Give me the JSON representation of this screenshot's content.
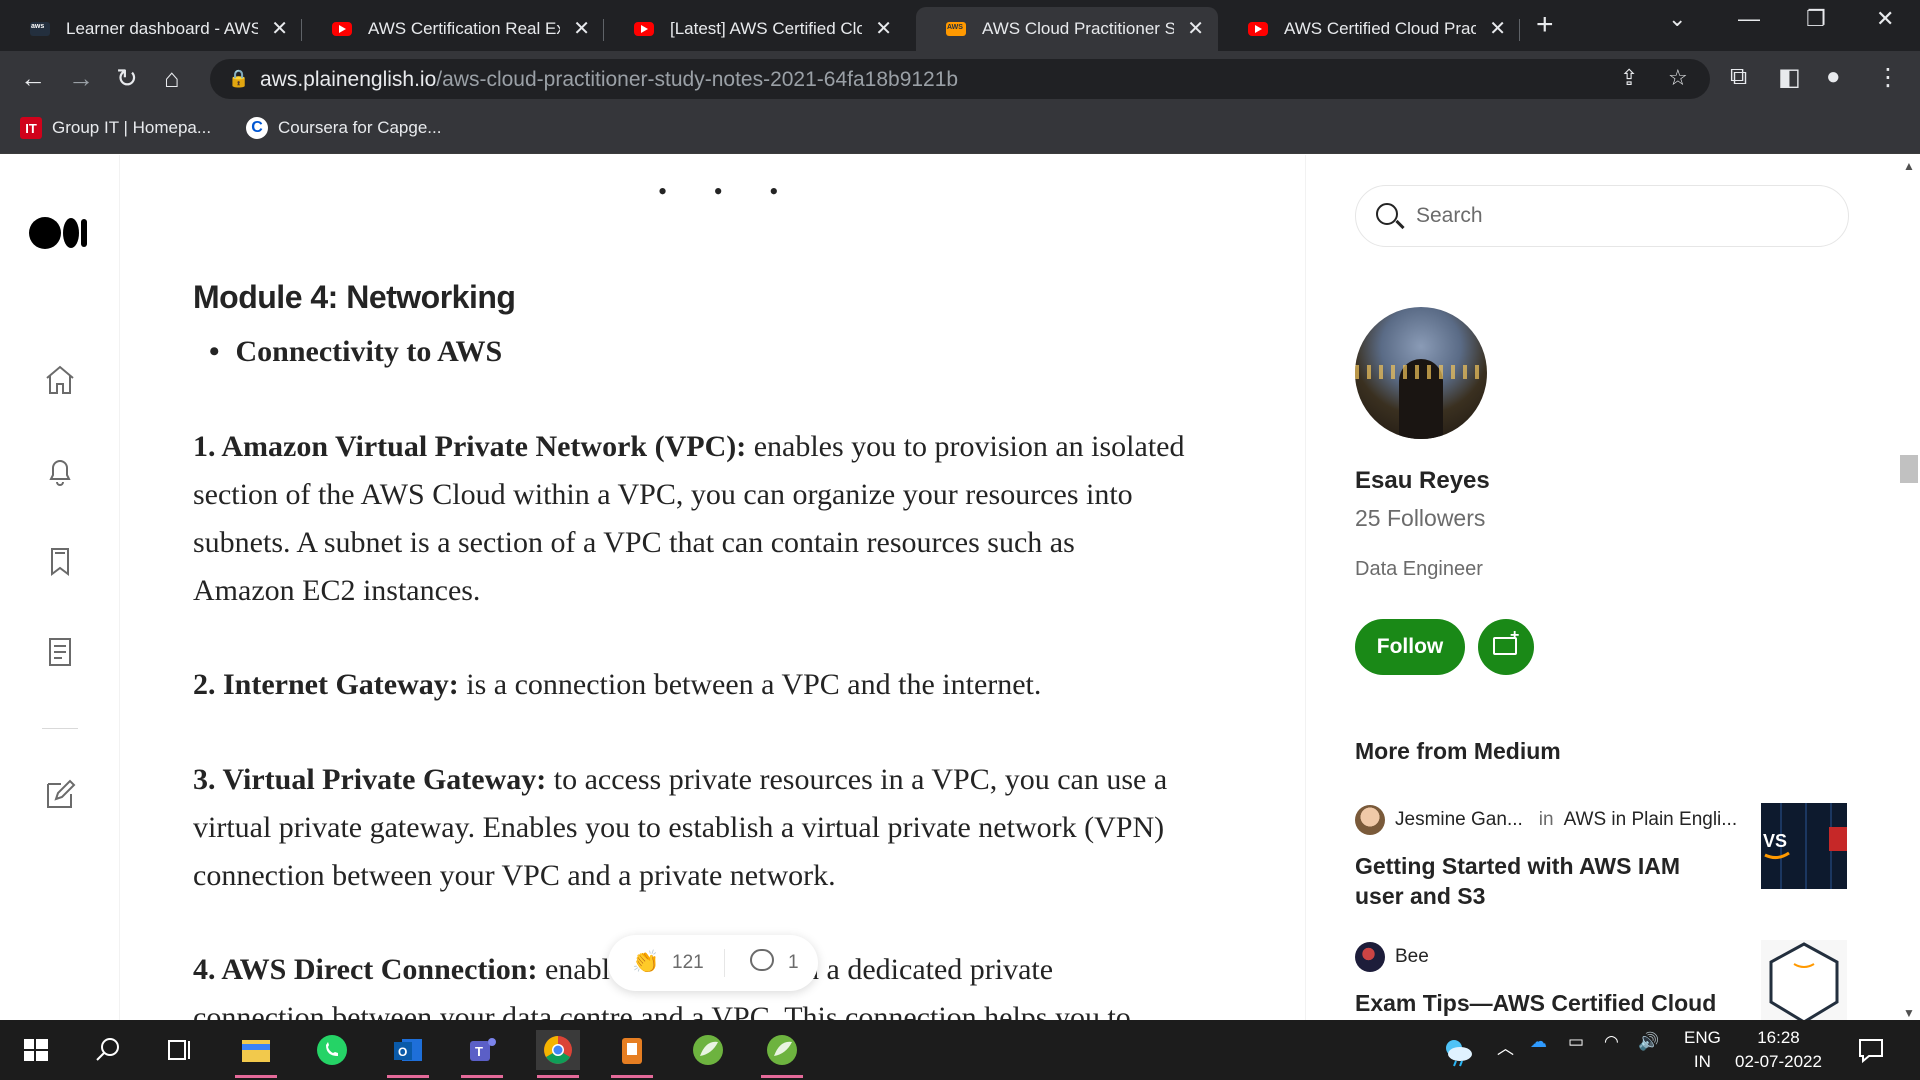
{
  "browser": {
    "tabs": [
      {
        "title": "Learner dashboard - AWS",
        "favicon": "aws-icon",
        "active": false
      },
      {
        "title": "AWS Certification Real Exa",
        "favicon": "youtube-icon",
        "active": false
      },
      {
        "title": "[Latest] AWS Certified Clo",
        "favicon": "youtube-icon",
        "active": false
      },
      {
        "title": "AWS Cloud Practitioner St",
        "favicon": "aws-orange-icon",
        "active": true
      },
      {
        "title": "AWS Certified Cloud Pract",
        "favicon": "youtube-icon",
        "active": false
      }
    ],
    "url_host": "aws.plainenglish.io",
    "url_path": "/aws-cloud-practitioner-study-notes-2021-64fa18b9121b",
    "bookmarks": [
      {
        "label": "Group IT | Homepa...",
        "icon": "IT"
      },
      {
        "label": "Coursera for Capge...",
        "icon": "C"
      }
    ]
  },
  "article": {
    "separator": "• • •",
    "heading": "Module 4: Networking",
    "bullet": "Connectivity to AWS",
    "paragraphs": [
      {
        "bold": "1. Amazon Virtual Private Network (VPC):",
        "lines": [
          "enables you to provision an isolated",
          "section of the AWS Cloud within a VPC, you can organize your resources into",
          "subnets. A subnet is a section of a VPC that can contain resources such as",
          "Amazon EC2 instances."
        ]
      },
      {
        "bold": "2. Internet Gateway:",
        "lines": [
          "is a connection between a VPC and the internet."
        ]
      },
      {
        "bold": "3. Virtual Private Gateway:",
        "lines": [
          "to access private resources in a VPC, you can use a",
          "virtual private gateway. Enables you to establish a virtual private network (VPN)",
          "connection between your VPC and a private network."
        ]
      },
      {
        "bold": "4. AWS Direct Connection:",
        "lines": [
          "enable you to establish a dedicated private",
          "connection between your data centre and a VPC. This connection helps you to"
        ]
      }
    ],
    "claps": "121",
    "responses": "1"
  },
  "sidebar": {
    "search_placeholder": "Search",
    "author": {
      "name": "Esau Reyes",
      "followers": "25 Followers",
      "bio": "Data Engineer"
    },
    "follow_label": "Follow",
    "more_heading": "More from Medium",
    "stories": [
      {
        "author": "Jesmine Gan...",
        "in": "in",
        "publication": "AWS in Plain Engli...",
        "title": "Getting Started with AWS IAM user and S3"
      },
      {
        "author": "Bee",
        "in": "",
        "publication": "",
        "title": "Exam Tips—AWS Certified Cloud"
      }
    ]
  },
  "taskbar": {
    "lang": "ENG",
    "region": "IN",
    "time": "16:28",
    "date": "02-07-2022"
  },
  "colors": {
    "follow_green": "#1a8917",
    "tab_bg": "#202124",
    "toolbar_bg": "#35363a"
  }
}
